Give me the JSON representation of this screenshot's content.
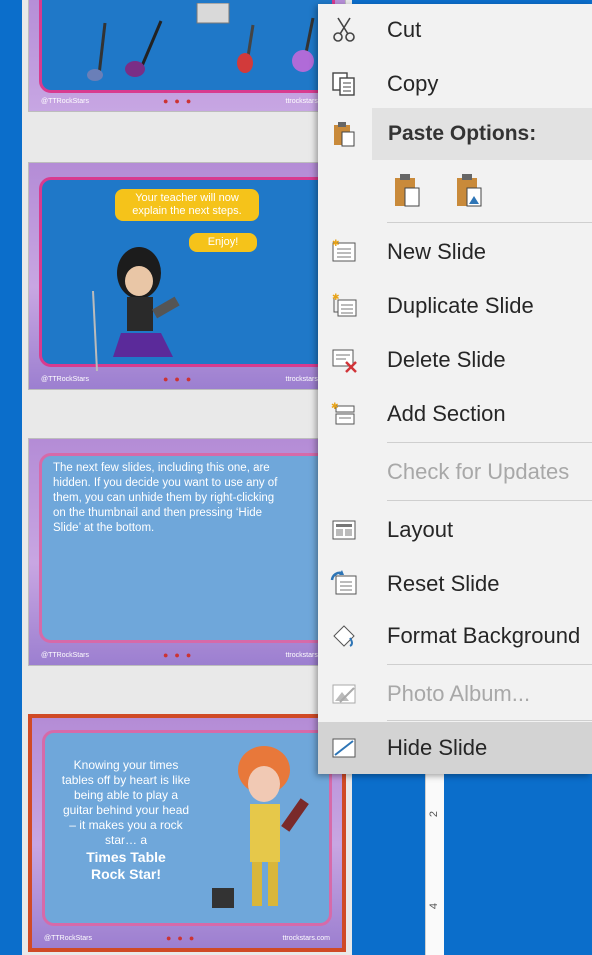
{
  "thumbnails": [
    {
      "number": "",
      "footer_left": "@TTRockStars",
      "footer_right": "ttrockstars.com"
    },
    {
      "number": "",
      "bubble_1": "Your teacher will now explain the next steps.",
      "bubble_2": "Enjoy!",
      "footer_left": "@TTRockStars",
      "footer_right": "ttrockstars.com"
    },
    {
      "number": "",
      "text": "The next few slides, including this one, are hidden. If you decide you want to use any of them, you can unhide them by right-clicking on the thumbnail and then pressing ‘Hide Slide’ at the bottom.",
      "footer_left": "@TTRockStars",
      "footer_right": "ttrockstars.com"
    },
    {
      "number": "",
      "text": "Knowing your times tables off by heart is like being able to play a guitar behind your head – it makes you a rock star… a",
      "text_strong": "Times Table Rock Star!",
      "footer_left": "@TTRockStars",
      "footer_right": "ttrockstars.com",
      "selected": true
    }
  ],
  "ruler": {
    "marks": [
      "2",
      "4"
    ]
  },
  "context_menu": {
    "items": [
      {
        "label": "Cut",
        "icon": "scissors-icon",
        "enabled": true
      },
      {
        "label": "Copy",
        "icon": "copy-icon",
        "enabled": true
      },
      {
        "label": "Paste Options:",
        "icon": "clipboard-icon",
        "enabled": true
      },
      {
        "label": "New Slide",
        "icon": "new-slide-icon",
        "enabled": true
      },
      {
        "label": "Duplicate Slide",
        "icon": "duplicate-slide-icon",
        "enabled": true
      },
      {
        "label": "Delete Slide",
        "icon": "delete-slide-icon",
        "enabled": true
      },
      {
        "label": "Add Section",
        "icon": "add-section-icon",
        "enabled": true
      },
      {
        "label": "Check for Updates",
        "icon": "",
        "enabled": false
      },
      {
        "label": "Layout",
        "icon": "layout-icon",
        "enabled": true
      },
      {
        "label": "Reset Slide",
        "icon": "reset-slide-icon",
        "enabled": true
      },
      {
        "label": "Format Background",
        "icon": "format-background-icon",
        "enabled": true
      },
      {
        "label": "Photo Album...",
        "icon": "photo-album-icon",
        "enabled": false
      },
      {
        "label": "Hide Slide",
        "icon": "hide-slide-icon",
        "enabled": true,
        "highlighted": true
      }
    ]
  },
  "colors": {
    "background": "#0b6ecb",
    "selected_border": "#d04a26",
    "slide_frame": "#d83b8f",
    "bubble": "#f5c31a"
  }
}
